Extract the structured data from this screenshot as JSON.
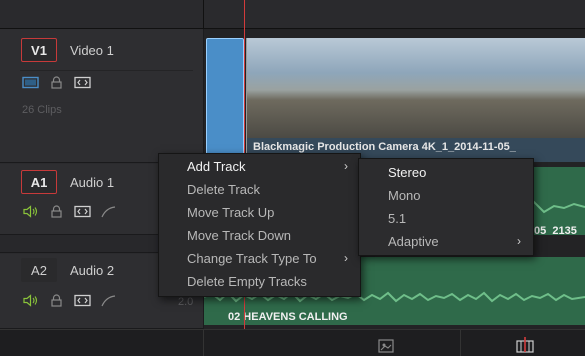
{
  "tracks": {
    "video1": {
      "id": "V1",
      "name": "Video 1",
      "clips": "26 Clips"
    },
    "audio1": {
      "id": "A1",
      "name": "Audio 1"
    },
    "audio2": {
      "id": "A2",
      "name": "Audio 2",
      "level": "2.0"
    }
  },
  "clips": {
    "video_title": "Blackmagic Production Camera 4K_1_2014-11-05_",
    "audio1_title": "05_2135",
    "audio2_title": "02 HEAVENS CALLING"
  },
  "context_menu": {
    "items": [
      {
        "label": "Add Track",
        "has_submenu": true
      },
      {
        "label": "Delete Track",
        "has_submenu": false
      },
      {
        "label": "Move Track Up",
        "has_submenu": false
      },
      {
        "label": "Move Track Down",
        "has_submenu": false
      },
      {
        "label": "Change Track Type To",
        "has_submenu": true
      },
      {
        "label": "Delete Empty Tracks",
        "has_submenu": false
      }
    ],
    "arrow": "›"
  },
  "submenu": {
    "items": [
      {
        "label": "Stereo",
        "has_submenu": false
      },
      {
        "label": "Mono",
        "has_submenu": false
      },
      {
        "label": "5.1",
        "has_submenu": false
      },
      {
        "label": "Adaptive",
        "has_submenu": true
      }
    ],
    "arrow": "›"
  },
  "colors": {
    "accent_red": "#c73a3a",
    "audio_clip": "#2f6a4a",
    "video_clip": "#4a8ec8",
    "volume_icon": "#8ac43a"
  }
}
